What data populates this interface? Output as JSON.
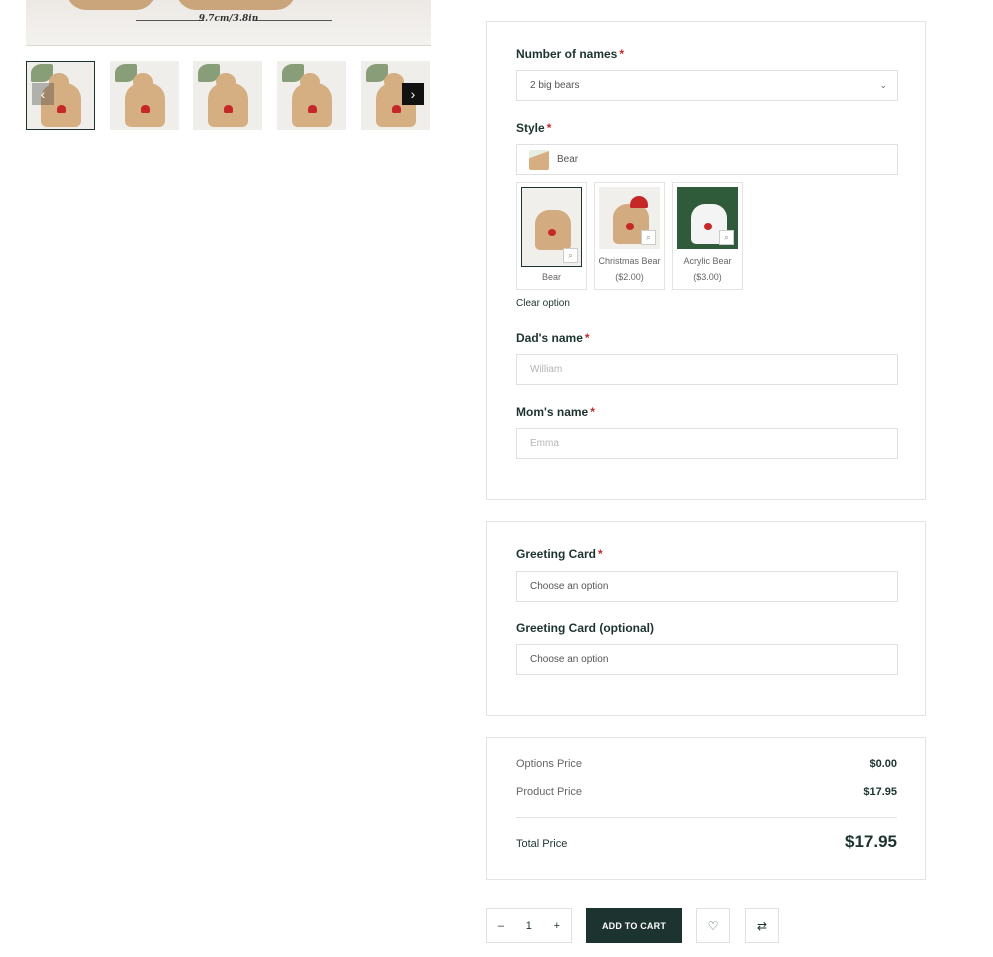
{
  "gallery": {
    "dimension_text": "9.7cm/3.8in",
    "prev_icon": "chevron-left-icon",
    "next_icon": "chevron-right-icon",
    "thumbnail_count": 5
  },
  "form": {
    "names": {
      "label": "Number of names",
      "required": "*",
      "value": "2 big bears"
    },
    "style": {
      "label": "Style",
      "required": "*",
      "value": "Bear",
      "options": [
        {
          "name": "Bear",
          "price": ""
        },
        {
          "name": "Christmas Bear",
          "price": "($2.00)"
        },
        {
          "name": "Acrylic Bear",
          "price": "($3.00)"
        }
      ],
      "clear_label": "Clear option"
    },
    "dad": {
      "label": "Dad's name",
      "required": "*",
      "placeholder": "William"
    },
    "mom": {
      "label": "Mom's name",
      "required": "*",
      "placeholder": "Emma"
    }
  },
  "greeting": {
    "card": {
      "label": "Greeting Card",
      "required": "*",
      "value": "Choose an option"
    },
    "card_optional": {
      "label": "Greeting Card (optional)",
      "value": "Choose an option"
    }
  },
  "prices": {
    "options_label": "Options Price",
    "options_value": "$0.00",
    "product_label": "Product Price",
    "product_value": "$17.95",
    "total_label": "Total Price",
    "total_value": "$17.95"
  },
  "actions": {
    "qty_minus": "–",
    "qty_value": "1",
    "qty_plus": "+",
    "add_to_cart": "ADD TO CART",
    "wishlist_icon": "heart-icon",
    "compare_icon": "compare-arrows-icon"
  },
  "colors": {
    "primary": "#1d3330",
    "required": "#c62828",
    "border": "#e3e3e3"
  }
}
